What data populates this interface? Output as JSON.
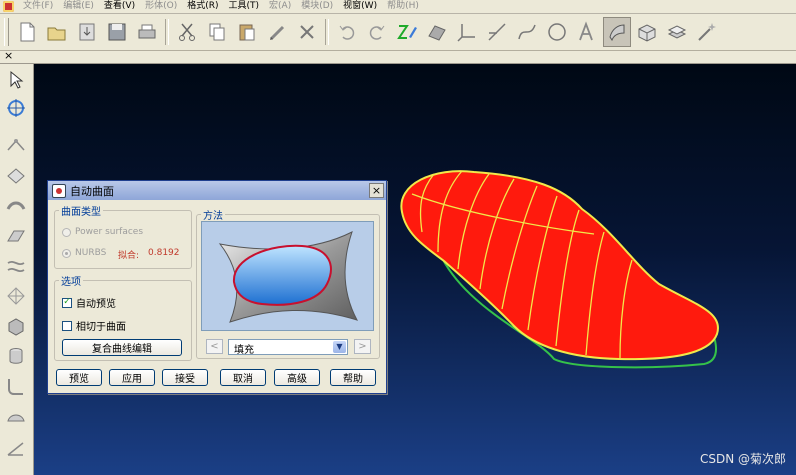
{
  "menu": {
    "items": [
      {
        "label": "文件(F)",
        "enabled": false
      },
      {
        "label": "编辑(E)",
        "enabled": false
      },
      {
        "label": "查看(V)",
        "enabled": true
      },
      {
        "label": "形体(O)",
        "enabled": false
      },
      {
        "label": "格式(R)",
        "enabled": true
      },
      {
        "label": "工具(T)",
        "enabled": true
      },
      {
        "label": "宏(A)",
        "enabled": false
      },
      {
        "label": "模块(D)",
        "enabled": false
      },
      {
        "label": "视窗(W)",
        "enabled": true
      },
      {
        "label": "帮助(H)",
        "enabled": false
      }
    ]
  },
  "toolbar": {
    "icons": [
      "new-icon",
      "open-icon",
      "import-icon",
      "save-icon",
      "print-icon",
      "cut-icon",
      "copy-icon",
      "paste-icon",
      "clear-icon",
      "delete-icon",
      "undo-icon",
      "redo-icon",
      "zoom-pen-icon",
      "surface-icon",
      "axis-icon",
      "line-icon",
      "curve-icon",
      "circle-icon",
      "text-icon",
      "surface-tool-icon",
      "box-icon",
      "layers-icon",
      "magic-icon"
    ],
    "active": "surface-tool-icon"
  },
  "strip": {
    "close_glyph": "×"
  },
  "dialog": {
    "title": "自动曲面",
    "close_glyph": "×",
    "surface_type": {
      "legend": "曲面类型",
      "option1": "Power surfaces",
      "option2": "NURBS",
      "fit_label": "拟合:",
      "fit_value": "0.8192"
    },
    "options": {
      "legend": "选项",
      "auto_preview": "自动预览",
      "tangent": "相切于曲面",
      "composite_button": "复合曲线编辑"
    },
    "method": {
      "legend": "方法",
      "select_value": "填充",
      "prev_glyph": "<",
      "next_glyph": ">"
    },
    "buttons": {
      "preview": "预览",
      "apply": "应用",
      "accept": "接受",
      "cancel": "取消",
      "advanced": "高级",
      "help": "帮助"
    }
  },
  "watermark": "CSDN @菊次郎",
  "colors": {
    "model_fill": "#ff1a0d",
    "model_lines": "#f2e84a",
    "model_edge": "#35c24a",
    "viewport_top": "#000814",
    "viewport_bottom": "#1b3f86",
    "dialog_title": "#8ea6d8"
  }
}
